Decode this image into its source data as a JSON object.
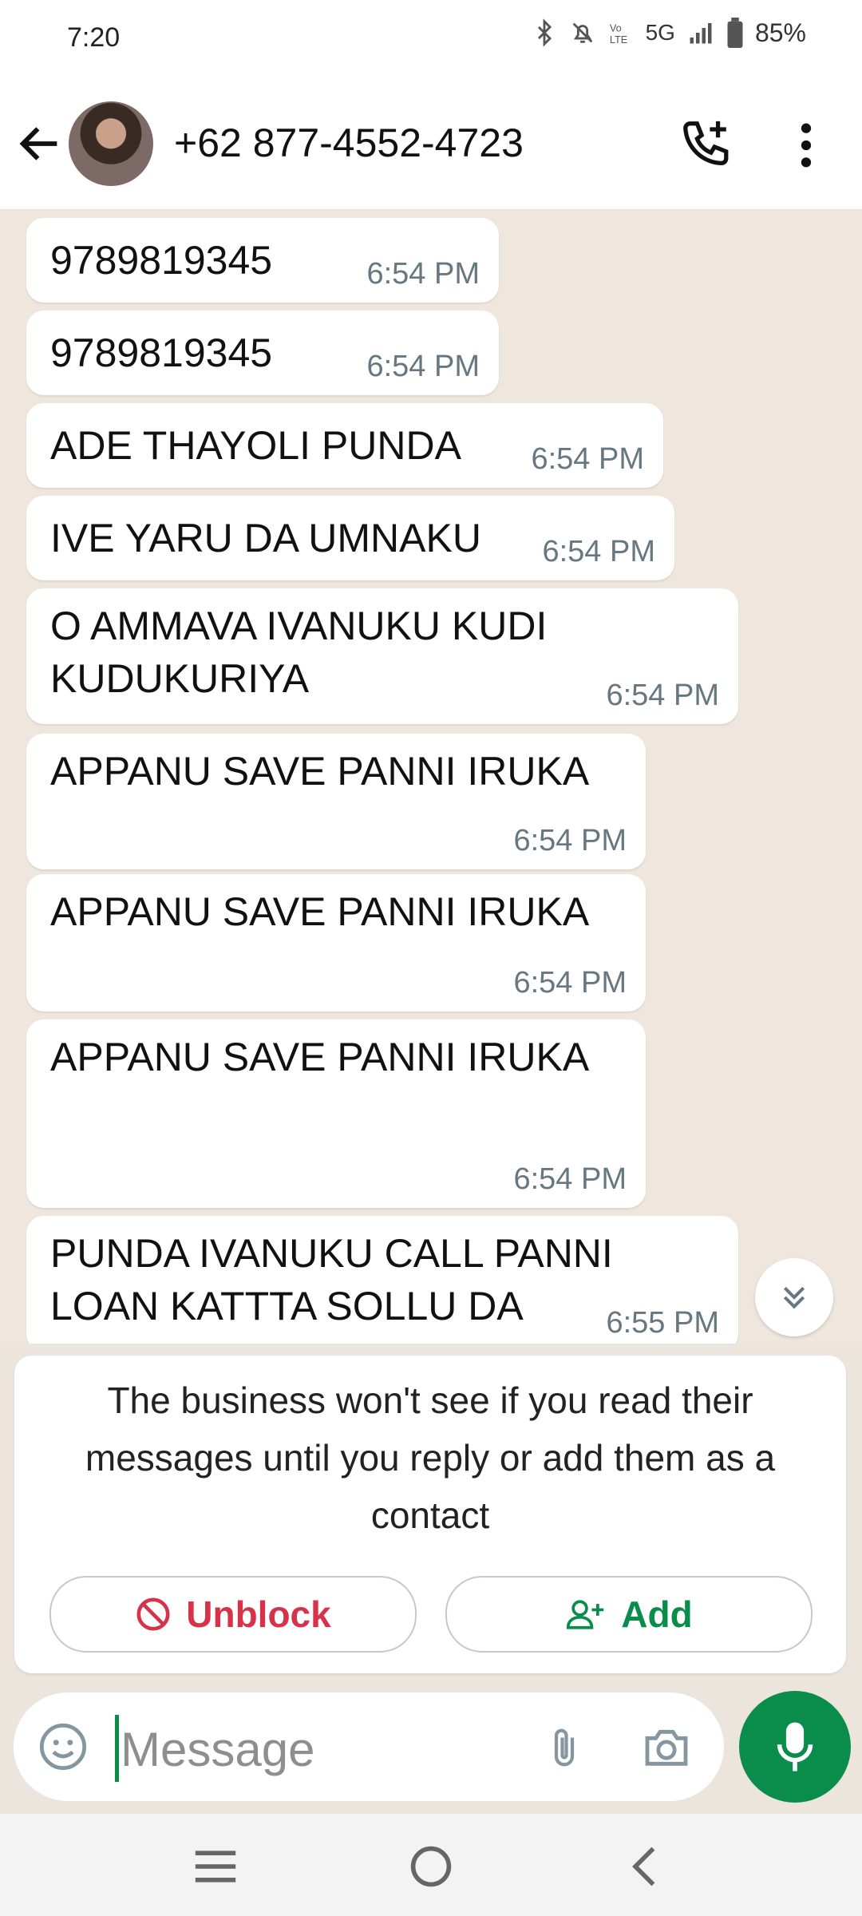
{
  "status_bar": {
    "time": "7:20",
    "battery": "85%",
    "network": "5G"
  },
  "header": {
    "contact": "+62 877-4552-4723"
  },
  "messages": [
    {
      "text": "9789819345",
      "time": "6:54 PM"
    },
    {
      "text": "9789819345",
      "time": "6:54 PM"
    },
    {
      "text": "ADE THAYOLI PUNDA",
      "time": "6:54 PM"
    },
    {
      "text": "IVE YARU DA UMNAKU",
      "time": "6:54 PM"
    },
    {
      "text": "O AMMAVA IVANUKU KUDI KUDUKURIYA",
      "time": "6:54 PM"
    },
    {
      "text": "APPANU SAVE PANNI IRUKA",
      "time": "6:54 PM"
    },
    {
      "text": "APPANU SAVE PANNI IRUKA",
      "time": "6:54 PM"
    },
    {
      "text": "APPANU SAVE PANNI IRUKA",
      "time": "6:54 PM"
    },
    {
      "text": "PUNDA IVANUKU CALL PANNI LOAN KATTTA SOLLU DA",
      "time": "6:55 PM"
    }
  ],
  "notice": {
    "text": "The business won't see if you read their messages until you reply or add them as a contact",
    "unblock_label": "Unblock",
    "add_label": "Add"
  },
  "composer": {
    "placeholder": "Message"
  },
  "colors": {
    "accent": "#0a8d4a",
    "danger": "#d6324a",
    "chat_bg": "#efe7de"
  }
}
